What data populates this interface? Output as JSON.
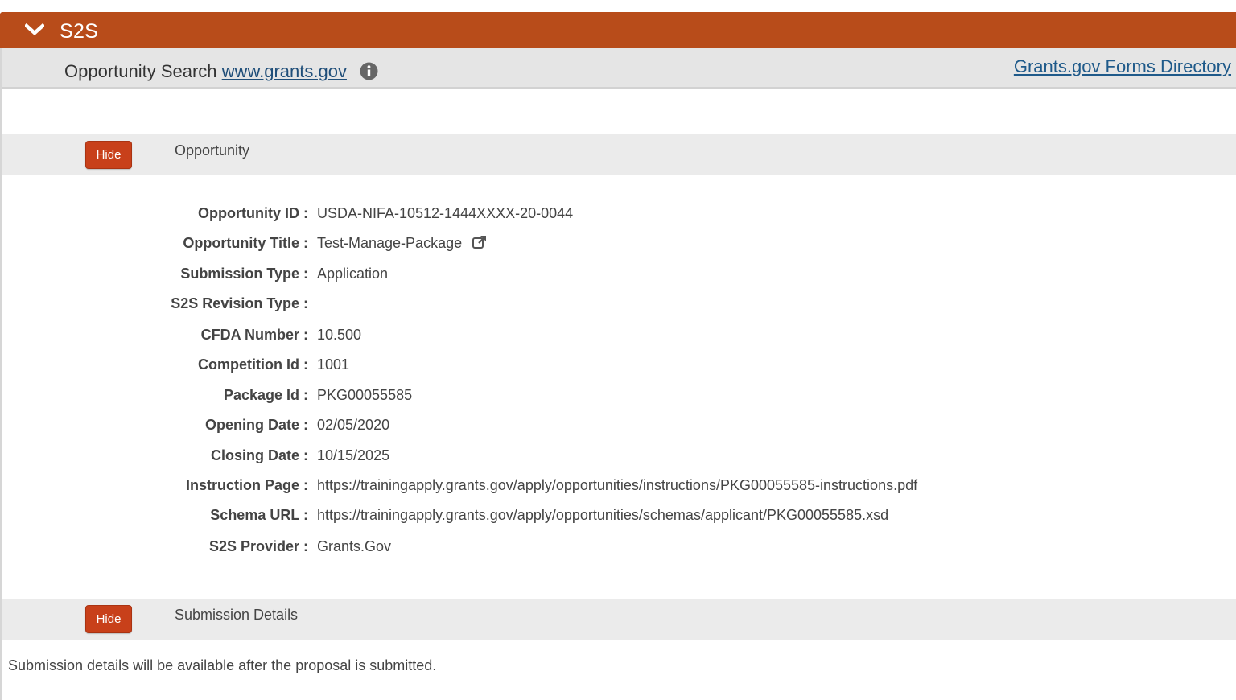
{
  "panel": {
    "title": "S2S"
  },
  "search": {
    "prefix": "Opportunity Search ",
    "link_text": "www.grants.gov",
    "forms_directory": "Grants.gov Forms Directory"
  },
  "opportunity_section": {
    "hide_label": "Hide",
    "title": "Opportunity",
    "fields": [
      {
        "label": "Opportunity ID :",
        "value": "USDA-NIFA-10512-1444XXXX-20-0044"
      },
      {
        "label": "Opportunity Title :",
        "value": "Test-Manage-Package"
      },
      {
        "label": "Submission Type :",
        "value": "Application"
      },
      {
        "label": "S2S Revision Type :",
        "value": ""
      },
      {
        "label": "CFDA Number :",
        "value": "10.500"
      },
      {
        "label": "Competition Id :",
        "value": "1001"
      },
      {
        "label": "Package Id :",
        "value": "PKG00055585"
      },
      {
        "label": "Opening Date :",
        "value": "02/05/2020"
      },
      {
        "label": "Closing Date :",
        "value": "10/15/2025"
      },
      {
        "label": "Instruction Page :",
        "value": "https://trainingapply.grants.gov/apply/opportunities/instructions/PKG00055585-instructions.pdf"
      },
      {
        "label": "Schema URL :",
        "value": "https://trainingapply.grants.gov/apply/opportunities/schemas/applicant/PKG00055585.xsd"
      },
      {
        "label": "S2S Provider :",
        "value": "Grants.Gov"
      }
    ]
  },
  "submission_section": {
    "hide_label": "Hide",
    "title": "Submission Details",
    "note": "Submission details will be available after the proposal is submitted."
  },
  "colors": {
    "header_bg": "#b84c1a",
    "button_bg": "#c8401a",
    "link": "#1f4e79"
  },
  "icons": {
    "collapse": "chevron-down-icon",
    "info": "info-icon",
    "external": "external-link-icon"
  }
}
